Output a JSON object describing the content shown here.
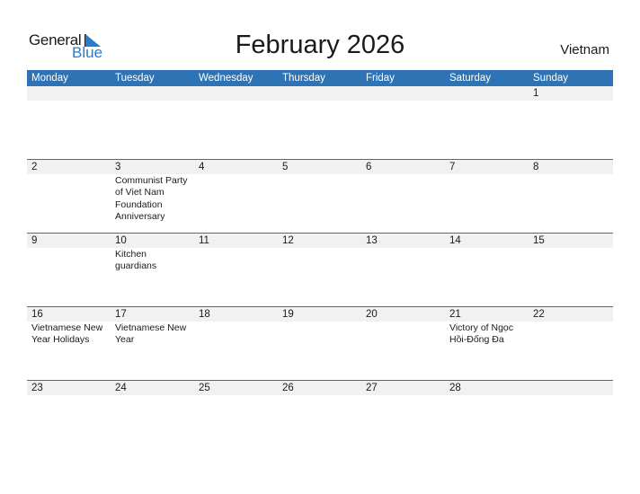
{
  "logo": {
    "general": "General",
    "blue": "Blue"
  },
  "title": "February 2026",
  "country": "Vietnam",
  "colors": {
    "header": "#2e74b5",
    "strip": "#f1f1f1",
    "logo_blue": "#2a7bc8"
  },
  "weekdays": [
    "Monday",
    "Tuesday",
    "Wednesday",
    "Thursday",
    "Friday",
    "Saturday",
    "Sunday"
  ],
  "weeks": [
    [
      {
        "d": ""
      },
      {
        "d": ""
      },
      {
        "d": ""
      },
      {
        "d": ""
      },
      {
        "d": ""
      },
      {
        "d": ""
      },
      {
        "d": "1"
      }
    ],
    [
      {
        "d": "2"
      },
      {
        "d": "3",
        "e": "Communist Party of Viet Nam Foundation Anniversary"
      },
      {
        "d": "4"
      },
      {
        "d": "5"
      },
      {
        "d": "6"
      },
      {
        "d": "7"
      },
      {
        "d": "8"
      }
    ],
    [
      {
        "d": "9"
      },
      {
        "d": "10",
        "e": "Kitchen guardians"
      },
      {
        "d": "11"
      },
      {
        "d": "12"
      },
      {
        "d": "13"
      },
      {
        "d": "14"
      },
      {
        "d": "15"
      }
    ],
    [
      {
        "d": "16",
        "e": "Vietnamese New Year Holidays"
      },
      {
        "d": "17",
        "e": "Vietnamese New Year"
      },
      {
        "d": "18"
      },
      {
        "d": "19"
      },
      {
        "d": "20"
      },
      {
        "d": "21",
        "e": "Victory of Ngọc Hồi-Đống Đa"
      },
      {
        "d": "22"
      }
    ],
    [
      {
        "d": "23"
      },
      {
        "d": "24"
      },
      {
        "d": "25"
      },
      {
        "d": "26"
      },
      {
        "d": "27"
      },
      {
        "d": "28"
      },
      {
        "d": ""
      }
    ]
  ]
}
